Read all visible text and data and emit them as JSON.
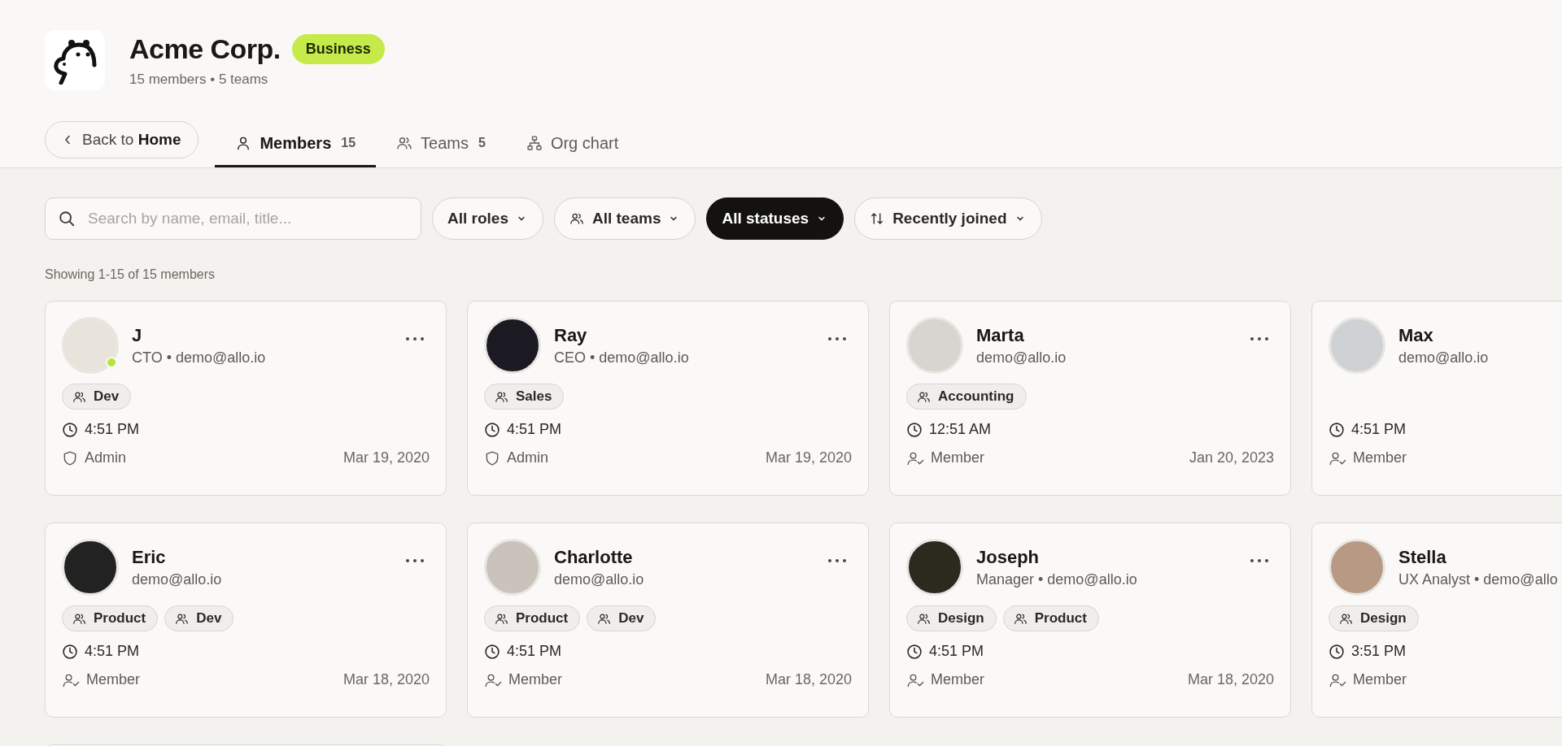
{
  "org": {
    "name": "Acme Corp.",
    "plan": "Business",
    "summary": "15 members • 5 teams"
  },
  "back": {
    "label": "Back to **Home**"
  },
  "tabs": [
    {
      "kind": "members",
      "label": "Members",
      "count": "15",
      "selected": true
    },
    {
      "kind": "teams",
      "label": "Teams",
      "count": "5",
      "selected": false
    },
    {
      "kind": "org",
      "label": "Org chart",
      "selected": false
    }
  ],
  "search": {
    "placeholder": "Search by name, email, title..."
  },
  "filters": [
    {
      "kind": "plain",
      "label": "All roles",
      "active": false
    },
    {
      "kind": "teams",
      "label": "All teams",
      "active": false
    },
    {
      "kind": "plain",
      "label": "All statuses",
      "active": true
    },
    {
      "kind": "sort",
      "label": "Recently joined",
      "active": false
    }
  ],
  "result_summary": "Showing 1-15 of 15 members",
  "members": [
    {
      "name": "J",
      "subtitle": "CTO • demo@allo.io",
      "online": true,
      "menu_button": true,
      "teams": [
        "Dev"
      ],
      "time": "4:51 PM",
      "role": "Admin",
      "kind": "admin",
      "joined": "Mar 19, 2020"
    },
    {
      "name": "Ray",
      "subtitle": "CEO • demo@allo.io",
      "online": false,
      "menu_button": true,
      "teams": [
        "Sales"
      ],
      "time": "4:51 PM",
      "role": "Admin",
      "kind": "admin",
      "joined": "Mar 19, 2020"
    },
    {
      "name": "Marta",
      "subtitle": "demo@allo.io",
      "online": false,
      "menu_button": true,
      "teams": [
        "Accounting"
      ],
      "time": "12:51 AM",
      "role": "Member",
      "kind": "member",
      "joined": "Jan 20, 2023"
    },
    {
      "name": "Max",
      "subtitle": "demo@allo.io",
      "online": false,
      "menu_button": false,
      "time": "4:51 PM",
      "role": "Member",
      "kind": "member"
    },
    {
      "name": "Eric",
      "subtitle": "demo@allo.io",
      "online": false,
      "menu_button": true,
      "teams": [
        "Product",
        "Dev"
      ],
      "time": "4:51 PM",
      "role": "Member",
      "kind": "member",
      "joined": "Mar 18, 2020"
    },
    {
      "name": "Charlotte",
      "subtitle": "demo@allo.io",
      "online": false,
      "menu_button": true,
      "teams": [
        "Product",
        "Dev"
      ],
      "time": "4:51 PM",
      "role": "Member",
      "kind": "member",
      "joined": "Mar 18, 2020"
    },
    {
      "name": "Joseph",
      "subtitle": "Manager • demo@allo.io",
      "online": false,
      "menu_button": true,
      "teams": [
        "Design",
        "Product"
      ],
      "time": "4:51 PM",
      "role": "Member",
      "kind": "member",
      "joined": "Mar 18, 2020"
    },
    {
      "name": "Stella",
      "subtitle": "UX Analyst • demo@allo",
      "online": false,
      "menu_button": false,
      "teams": [
        "Design"
      ],
      "time": "3:51 PM",
      "role": "Member",
      "kind": "member"
    }
  ]
}
